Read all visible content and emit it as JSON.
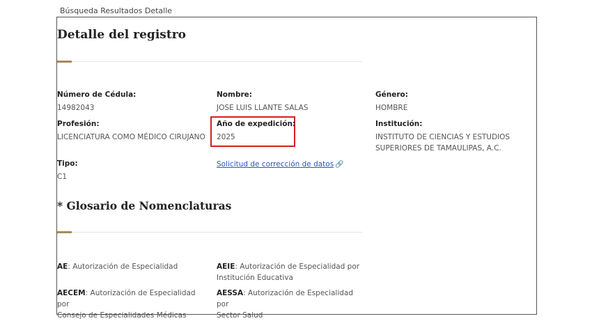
{
  "breadcrumb": "Búsqueda Resultados Detalle",
  "page_title": "Detalle del registro",
  "colors": {
    "accent": "#a78a5a",
    "highlight": "#d62020",
    "link": "#2b55b8"
  },
  "fields": {
    "cedula": {
      "label": "Número de Cédula:",
      "value": "14982043"
    },
    "nombre": {
      "label": "Nombre:",
      "value": "JOSE LUIS LLANTE SALAS"
    },
    "genero": {
      "label": "Género:",
      "value": "HOMBRE"
    },
    "profesion": {
      "label": "Profesión:",
      "value": "LICENCIATURA COMO MÉDICO CIRUJANO"
    },
    "anio": {
      "label": "Año de expedición:",
      "value": "2025"
    },
    "institucion": {
      "label": "Institución:",
      "value_line1": "INSTITUTO DE CIENCIAS Y ESTUDIOS",
      "value_line2": "SUPERIORES DE TAMAULIPAS, A.C."
    },
    "tipo": {
      "label": "Tipo:",
      "value": "C1"
    }
  },
  "correction_link": {
    "label": "Solicitud de corrección de datos",
    "icon": "link-icon"
  },
  "glossary": {
    "title": "* Glosario de Nomenclaturas",
    "items": [
      {
        "abbr": "AE",
        "text": ": Autorización de Especialidad",
        "text2": ""
      },
      {
        "abbr": "AEIE",
        "text": ": Autorización de Especialidad por",
        "text2": "Institución Educativa"
      },
      {
        "abbr": "AECEM",
        "text": ": Autorización de Especialidad por",
        "text2": "Consejo de Especialidades Médicas"
      },
      {
        "abbr": "AESSA",
        "text": ": Autorización de Especialidad por",
        "text2": "Sector Salud"
      }
    ]
  }
}
